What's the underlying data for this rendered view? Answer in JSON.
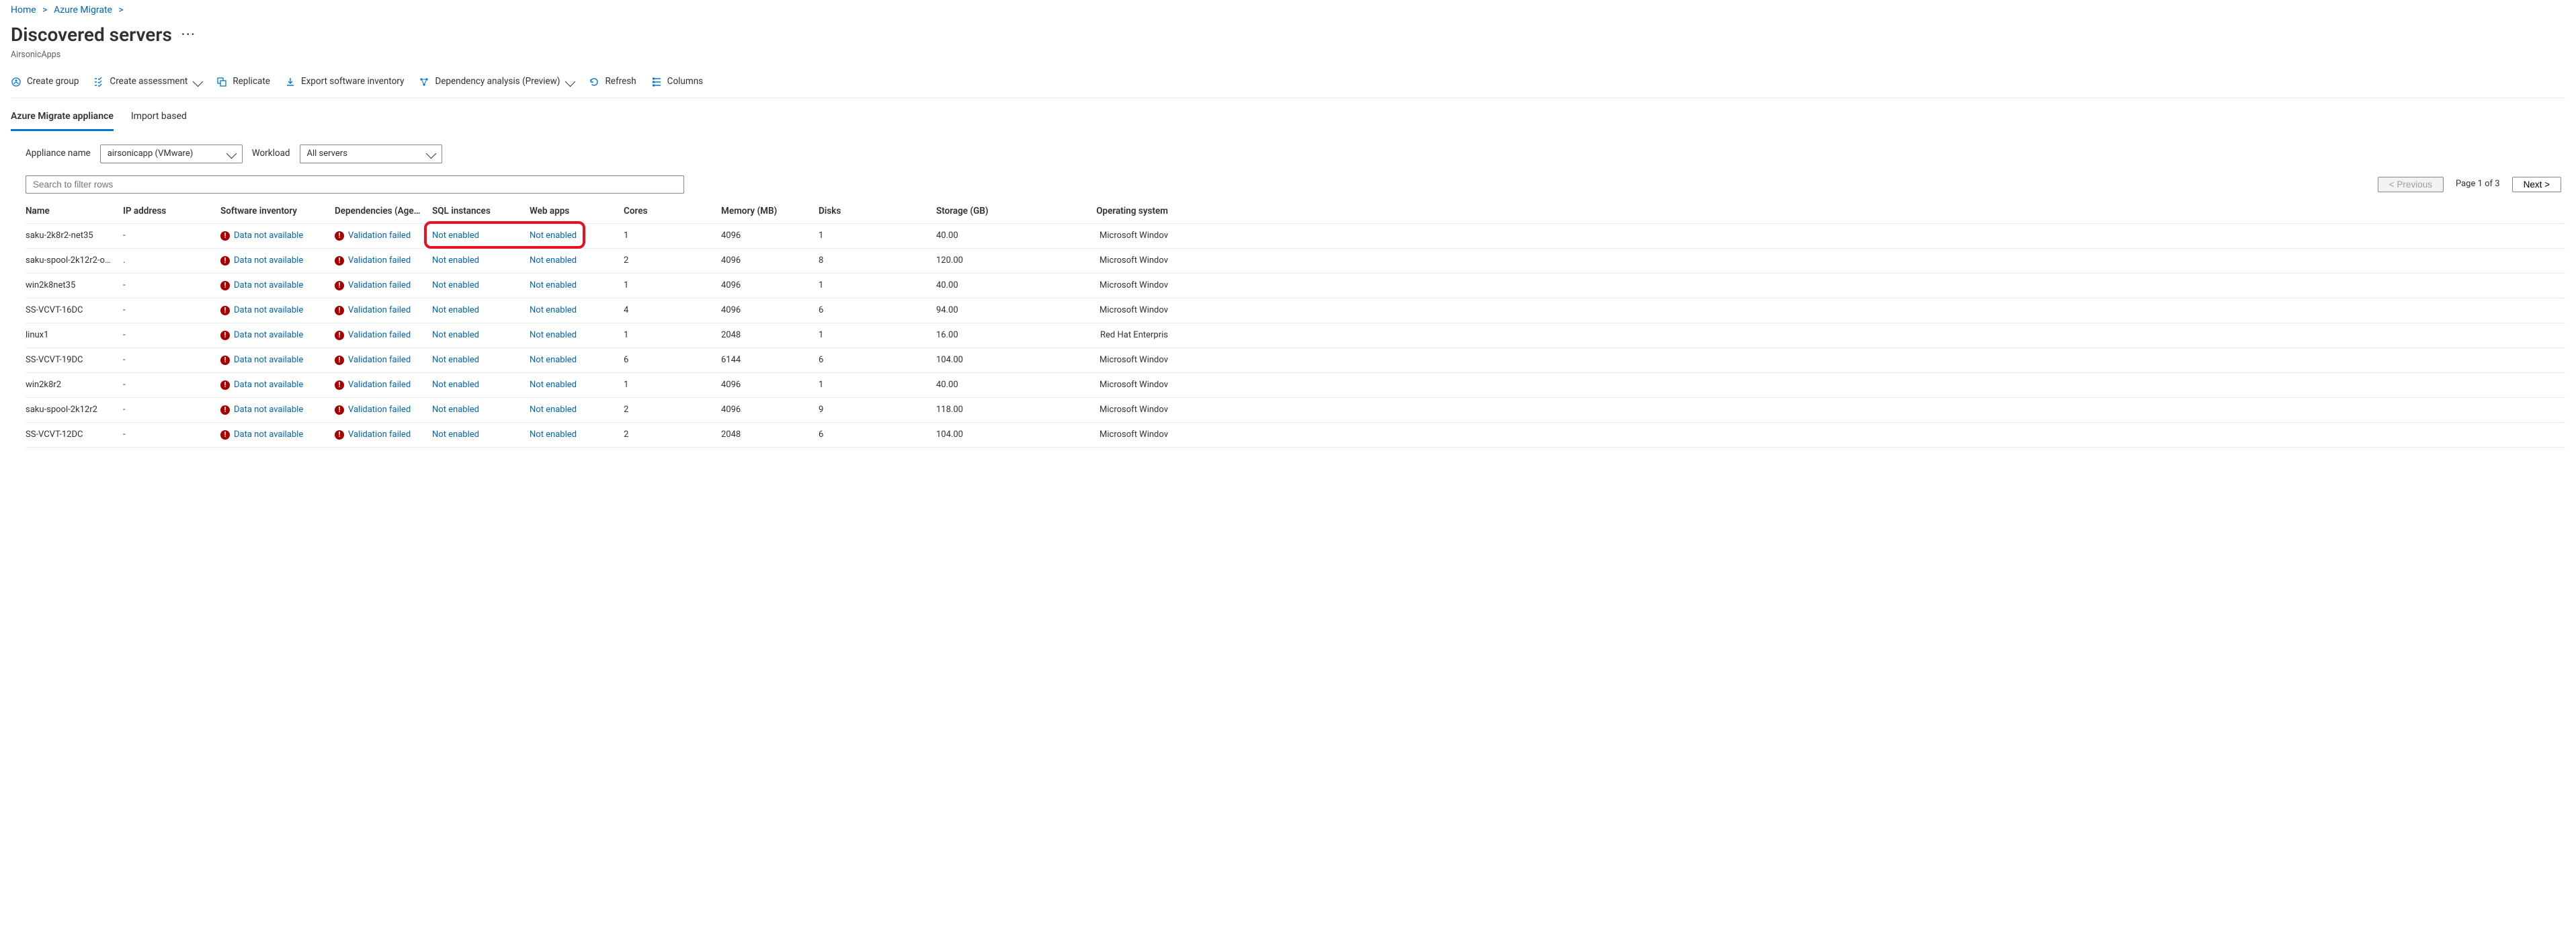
{
  "breadcrumbs": [
    "Home",
    "Azure Migrate"
  ],
  "page_title": "Discovered servers",
  "subtitle": "AirsonicApps",
  "toolbar": {
    "create_group": "Create group",
    "create_assessment": "Create assessment",
    "replicate": "Replicate",
    "export_inventory": "Export software inventory",
    "dependency_analysis": "Dependency analysis (Preview)",
    "refresh": "Refresh",
    "columns": "Columns"
  },
  "tabs": {
    "appliance": "Azure Migrate appliance",
    "import": "Import based"
  },
  "filters": {
    "appliance_label": "Appliance name",
    "appliance_value": "airsonicapp (VMware)",
    "workload_label": "Workload",
    "workload_value": "All servers"
  },
  "search_placeholder": "Search to filter rows",
  "pager": {
    "prev": "< Previous",
    "status": "Page 1 of 3",
    "next": "Next >"
  },
  "columns": {
    "name": "Name",
    "ip": "IP address",
    "software": "Software inventory",
    "deps": "Dependencies (Age…",
    "sql": "SQL instances",
    "web": "Web apps",
    "cores": "Cores",
    "memory": "Memory (MB)",
    "disks": "Disks",
    "storage": "Storage (GB)",
    "os": "Operating system"
  },
  "status_text": {
    "data_na": "Data not available",
    "val_failed": "Validation failed",
    "not_enabled": "Not enabled"
  },
  "rows": [
    {
      "name": "saku-2k8r2-net35",
      "ip": "-",
      "cores": "1",
      "memory": "4096",
      "disks": "1",
      "storage": "40.00",
      "os": "Microsoft Windov"
    },
    {
      "name": "saku-spool-2k12r2-o…",
      "ip": ".",
      "cores": "2",
      "memory": "4096",
      "disks": "8",
      "storage": "120.00",
      "os": "Microsoft Windov"
    },
    {
      "name": "win2k8net35",
      "ip": "-",
      "cores": "1",
      "memory": "4096",
      "disks": "1",
      "storage": "40.00",
      "os": "Microsoft Windov"
    },
    {
      "name": "SS-VCVT-16DC",
      "ip": "-",
      "cores": "4",
      "memory": "4096",
      "disks": "6",
      "storage": "94.00",
      "os": "Microsoft Windov"
    },
    {
      "name": "linux1",
      "ip": "-",
      "cores": "1",
      "memory": "2048",
      "disks": "1",
      "storage": "16.00",
      "os": "Red Hat Enterpris"
    },
    {
      "name": "SS-VCVT-19DC",
      "ip": "-",
      "cores": "6",
      "memory": "6144",
      "disks": "6",
      "storage": "104.00",
      "os": "Microsoft Windov"
    },
    {
      "name": "win2k8r2",
      "ip": "-",
      "cores": "1",
      "memory": "4096",
      "disks": "1",
      "storage": "40.00",
      "os": "Microsoft Windov"
    },
    {
      "name": "saku-spool-2k12r2",
      "ip": "-",
      "cores": "2",
      "memory": "4096",
      "disks": "9",
      "storage": "118.00",
      "os": "Microsoft Windov"
    },
    {
      "name": "SS-VCVT-12DC",
      "ip": "-",
      "cores": "2",
      "memory": "2048",
      "disks": "6",
      "storage": "104.00",
      "os": "Microsoft Windov"
    }
  ]
}
